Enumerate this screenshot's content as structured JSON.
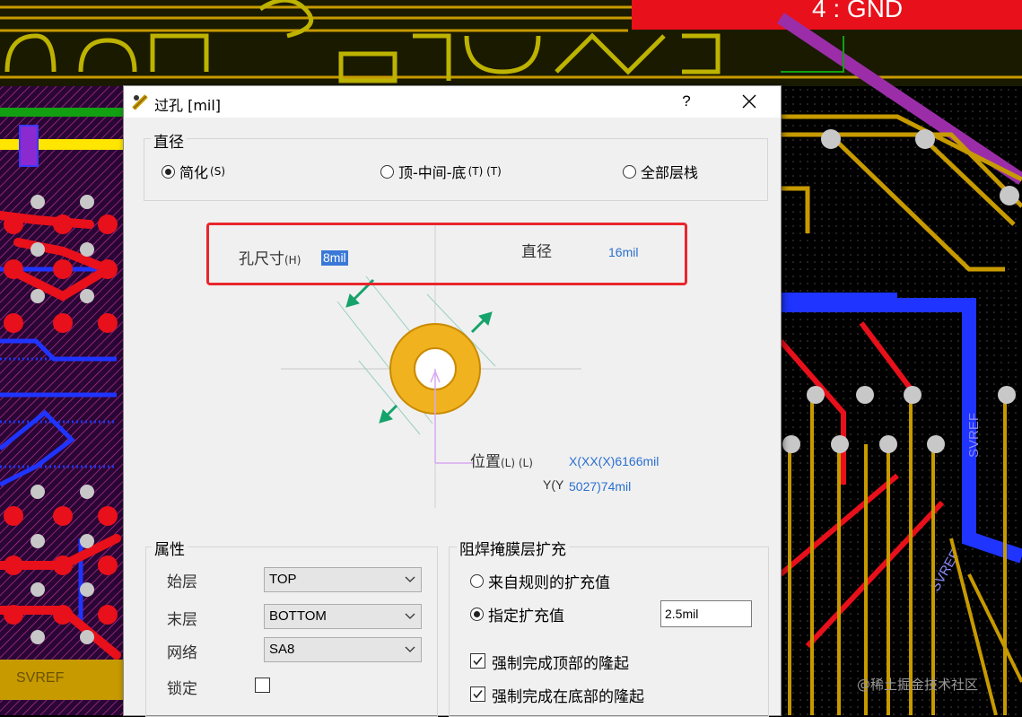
{
  "background": {
    "layer_label": "4 : GND",
    "silk_texts": [
      "SVREF",
      "SVREF",
      "SVREF",
      "SVREF",
      "SVREF"
    ],
    "colors": {
      "top_layer": "#e8101a",
      "bottom_layer": "#1f34ff",
      "mid_layer": "#c79a00",
      "silk": "#bdb300",
      "via_ring": "#c8c8c8"
    }
  },
  "dialog": {
    "title": "过孔 [mil]",
    "help_label": "?",
    "diameter_group": {
      "title": "直径",
      "options": [
        {
          "label": "简化",
          "hotkey": "(S)",
          "selected": true
        },
        {
          "label": "顶-中间-底",
          "hotkey": "(T) (T)",
          "selected": false
        },
        {
          "label": "全部层栈",
          "hotkey": "",
          "selected": false
        }
      ]
    },
    "hole": {
      "label": "孔尺寸",
      "hotkey": "(H)",
      "value": "8mil"
    },
    "diameter": {
      "label": "直径",
      "value": "16mil"
    },
    "position": {
      "label": "位置",
      "hotkey": "(L) (L)",
      "x_value": "X(XX(X)6166mil",
      "y_label": "Y(Y",
      "y_value": "5027)74mil"
    },
    "properties": {
      "title": "属性",
      "start_layer": {
        "label": "始层",
        "value": "TOP"
      },
      "end_layer": {
        "label": "末层",
        "value": "BOTTOM"
      },
      "net": {
        "label": "网络",
        "value": "SA8"
      },
      "lock": {
        "label": "锁定",
        "checked": false
      }
    },
    "solder_mask": {
      "title": "阻焊掩膜层扩充",
      "from_rule": {
        "label": "来自规则的扩充值",
        "selected": false
      },
      "specified": {
        "label": "指定扩充值",
        "selected": true,
        "value": "2.5mil"
      },
      "force_top": {
        "label": "强制完成顶部的隆起",
        "checked": true
      },
      "force_bottom": {
        "label": "强制完成在底部的隆起",
        "checked": true
      }
    },
    "colors": {
      "annular_ring": "#f0b21e",
      "arrow": "#15a36b",
      "highlight_box": "#e8262c",
      "value_blue": "#2a6fd0"
    }
  },
  "watermark": "@稀土掘金技术社区"
}
